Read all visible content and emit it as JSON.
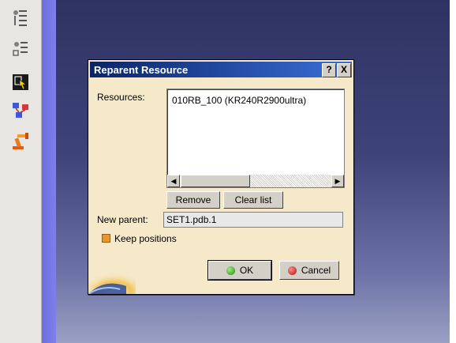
{
  "dialog": {
    "title": "Reparent Resource",
    "help_label": "?",
    "close_label": "X",
    "resources_label": "Resources:",
    "resources": [
      "010RB_100 (KR240R2900ultra)"
    ],
    "remove_label": "Remove",
    "clear_list_label": "Clear list",
    "new_parent_label": "New parent:",
    "new_parent_value": "SET1.pdb.1",
    "keep_positions_label": "Keep positions",
    "ok_label": "OK",
    "cancel_label": "Cancel"
  },
  "toolbar": {
    "icons": [
      "tree-text-icon",
      "tree-link-icon",
      "select-cursor-icon",
      "network-icon",
      "robot-arm-icon"
    ]
  },
  "colors": {
    "dialog_bg": "#f6e9c9",
    "titlebar": "#0a246a",
    "viewport": "#3e4378",
    "checkbox": "#e9962a"
  }
}
